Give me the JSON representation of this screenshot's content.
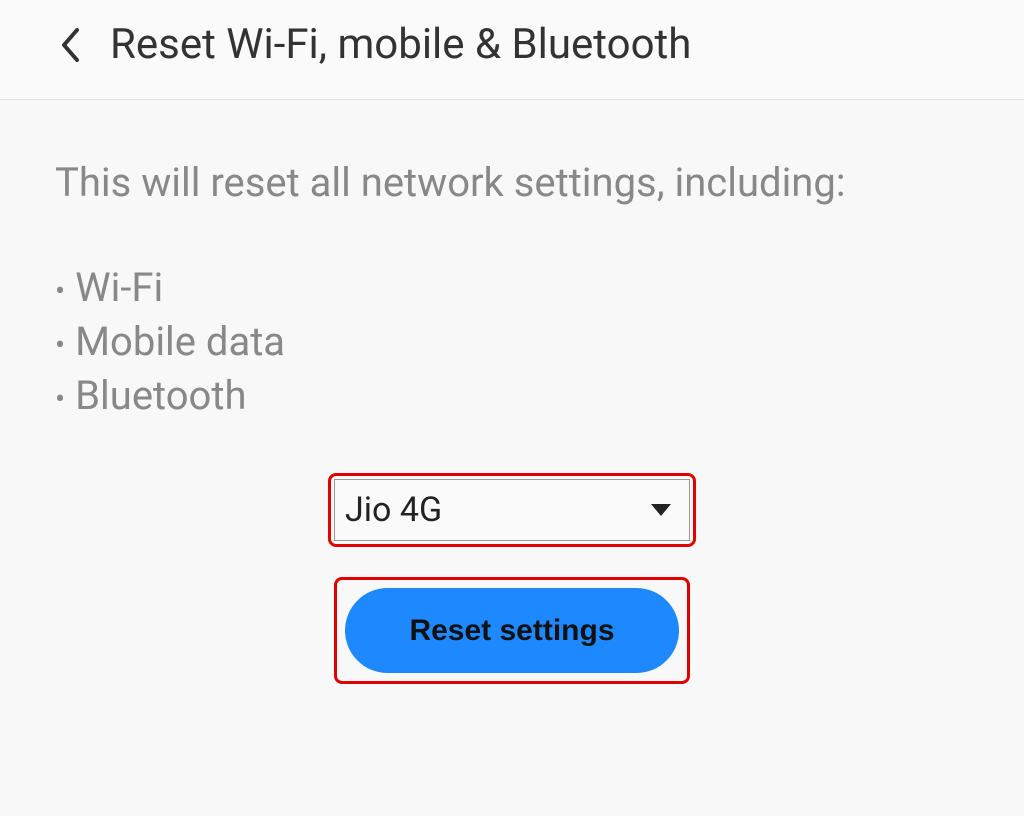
{
  "header": {
    "title": "Reset Wi-Fi, mobile & Bluetooth"
  },
  "content": {
    "description": "This will reset all network settings, including:",
    "bullets": {
      "item0": "Wi-Fi",
      "item1": "Mobile data",
      "item2": "Bluetooth"
    }
  },
  "dropdown": {
    "selected": "Jio 4G"
  },
  "button": {
    "label": "Reset settings"
  }
}
